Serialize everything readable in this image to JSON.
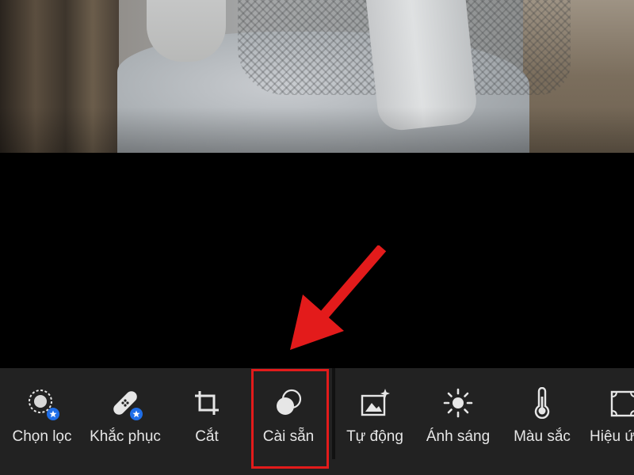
{
  "toolbar": {
    "tools": [
      {
        "label": "Chọn lọc",
        "icon": "selective-icon",
        "premium": true
      },
      {
        "label": "Khắc phục",
        "icon": "healing-bandage-icon",
        "premium": true
      },
      {
        "label": "Cắt",
        "icon": "crop-icon",
        "premium": false
      },
      {
        "label": "Cài sẵn",
        "icon": "presets-icon",
        "premium": false,
        "highlighted": true
      },
      {
        "label": "Tự động",
        "icon": "auto-enhance-icon",
        "premium": false
      },
      {
        "label": "Ánh sáng",
        "icon": "light-sun-icon",
        "premium": false
      },
      {
        "label": "Màu sắc",
        "icon": "color-thermometer-icon",
        "premium": false
      },
      {
        "label": "Hiệu ứ",
        "icon": "effects-icon",
        "premium": false
      }
    ]
  },
  "colors": {
    "toolbar_bg": "#222222",
    "highlight": "#e31b1b",
    "badge": "#1f6ee8"
  }
}
